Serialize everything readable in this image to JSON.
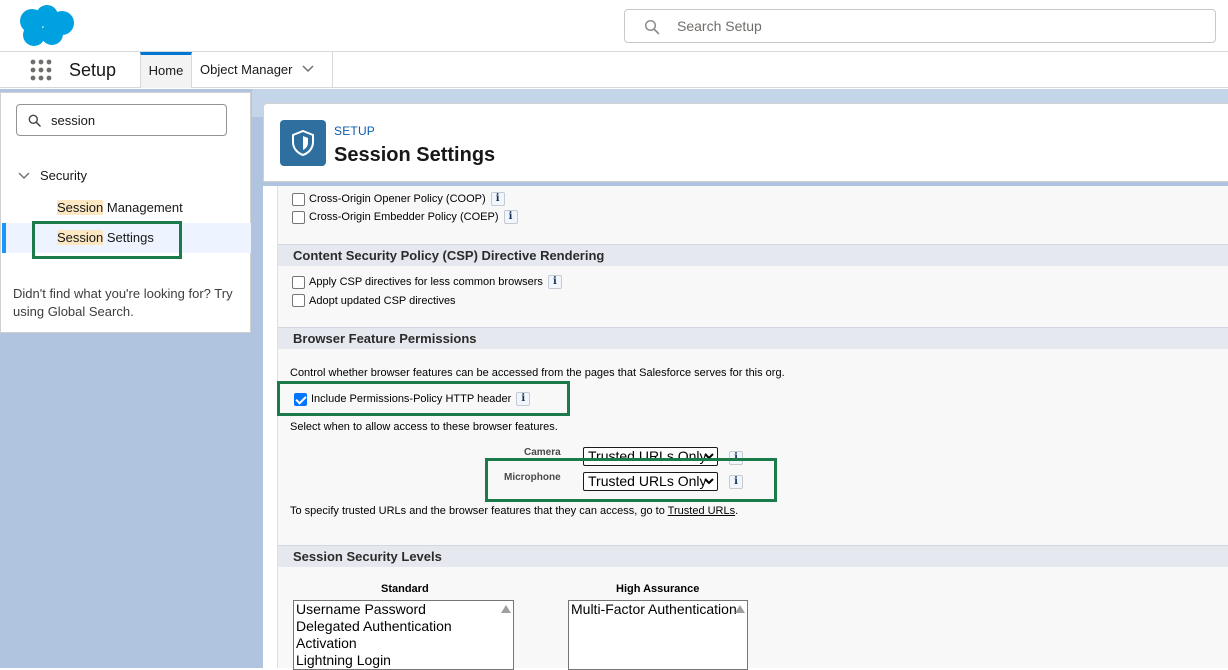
{
  "header": {
    "search_placeholder": "Search Setup"
  },
  "nav": {
    "app_name": "Setup",
    "tabs": [
      {
        "label": "Home"
      },
      {
        "label": "Object Manager"
      }
    ]
  },
  "sidebar": {
    "quick_find_value": "session",
    "section_label": "Security",
    "items": [
      {
        "highlight": "Session",
        "rest": " Management"
      },
      {
        "highlight": "Session",
        "rest": " Settings"
      }
    ],
    "not_found_text": "Didn't find what you're looking for? Try using Global Search."
  },
  "page_header": {
    "breadcrumb": "SETUP",
    "title": "Session Settings"
  },
  "content": {
    "top_checkboxes": [
      {
        "label": "Cross-Origin Opener Policy (COOP)",
        "checked": false
      },
      {
        "label": "Cross-Origin Embedder Policy (COEP)",
        "checked": false
      }
    ],
    "csp": {
      "heading": "Content Security Policy (CSP) Directive Rendering",
      "checkboxes": [
        {
          "label": "Apply CSP directives for less common browsers",
          "checked": false
        },
        {
          "label": "Adopt updated CSP directives",
          "checked": false
        }
      ]
    },
    "browser_perms": {
      "heading": "Browser Feature Permissions",
      "description": "Control whether browser features can be accessed from the pages that Salesforce serves for this org.",
      "include_header_label": "Include Permissions-Policy HTTP header",
      "include_header_checked": true,
      "select_prompt": "Select when to allow access to these browser features.",
      "features": [
        {
          "label": "Camera",
          "value": "Trusted URLs Only"
        },
        {
          "label": "Microphone",
          "value": "Trusted URLs Only"
        }
      ],
      "trusted_text_before": "To specify trusted URLs and the browser features that they can access, go to ",
      "trusted_link": "Trusted URLs",
      "trusted_text_after": "."
    },
    "security_levels": {
      "heading": "Session Security Levels",
      "standard_label": "Standard",
      "standard_options": [
        "Username Password",
        "Delegated Authentication",
        "Activation",
        "Lightning Login"
      ],
      "high_label": "High Assurance",
      "high_options": [
        "Multi-Factor Authentication"
      ]
    }
  },
  "colors": {
    "brand_blue": "#00a1e0",
    "highlight_box": "#1b7b4b",
    "search_highlight": "#fbe7c1"
  }
}
